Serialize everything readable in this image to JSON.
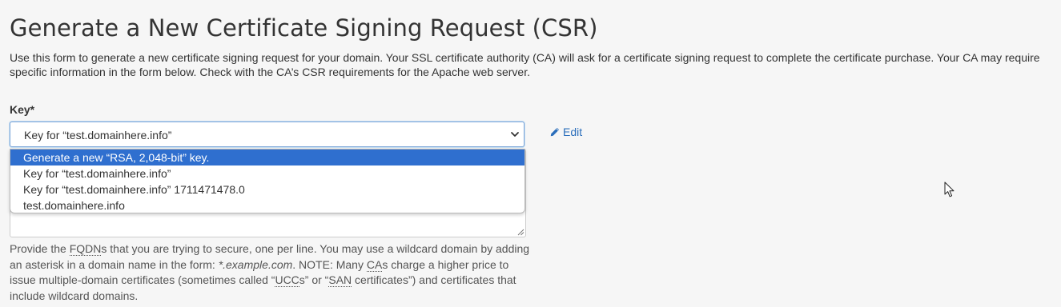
{
  "page": {
    "title": "Generate a New Certificate Signing Request (CSR)",
    "intro": "Use this form to generate a new certificate signing request for your domain. Your SSL certificate authority (CA) will ask for a certificate signing request to complete the certificate purchase. Your CA may require specific information in the form below. Check with the CA’s CSR requirements for the Apache web server."
  },
  "key_field": {
    "label": "Key*",
    "selected_value": "Key for “test.domainhere.info”",
    "edit_label": "Edit",
    "options": [
      "Generate a new “RSA, 2,048-bit” key.",
      "Key for “test.domainhere.info”",
      "Key for “test.domainhere.info” 1711471478.0",
      "test.domainhere.info"
    ],
    "highlighted_option_index": 0
  },
  "domains_help": {
    "t1": "Provide the ",
    "fqdn": "FQDN",
    "t2": "s that you are trying to secure, one per line. You may use a wildcard domain by adding an asterisk in a domain name in the form: ",
    "example": "*.example.com",
    "t3": ". NOTE: Many ",
    "ca": "CA",
    "t4": "s charge a higher price to issue multiple-domain certificates (sometimes called “",
    "ucc": "UCC",
    "t5": "s” or “",
    "san": "SAN",
    "t6": " certificates”) and certificates that include wildcard domains."
  },
  "colors": {
    "highlight": "#2f6fcf",
    "link": "#2a6ebb",
    "background": "#f6f6f6"
  },
  "icons": {
    "edit": "pencil-icon",
    "select": "chevron-down-icon",
    "cursor": "mouse-pointer-icon"
  }
}
